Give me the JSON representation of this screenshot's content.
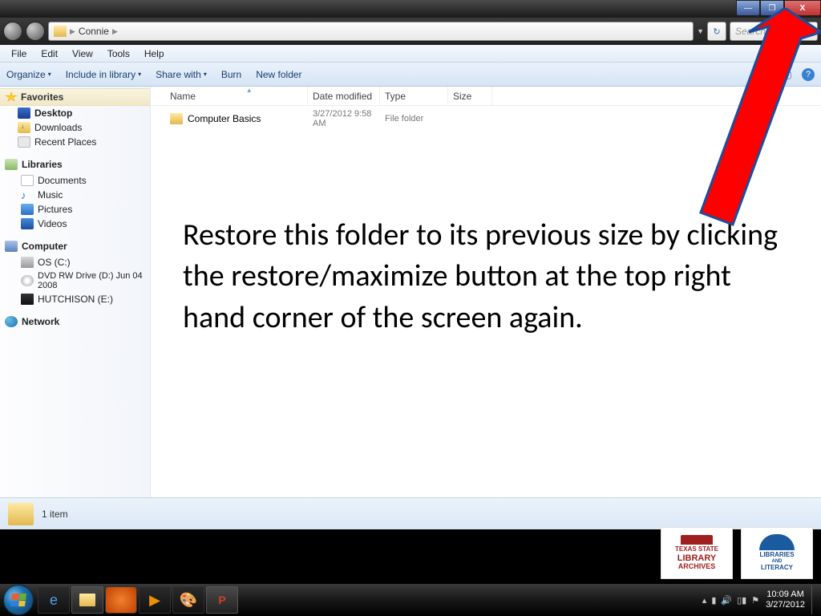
{
  "titlebar": {
    "min": "—",
    "max": "❐",
    "close": "X"
  },
  "address": {
    "folder": "Connie",
    "search_placeholder": "Search"
  },
  "menu": {
    "file": "File",
    "edit": "Edit",
    "view": "View",
    "tools": "Tools",
    "help": "Help"
  },
  "toolbar": {
    "organize": "Organize",
    "include": "Include in library",
    "share": "Share with",
    "burn": "Burn",
    "newfolder": "New folder"
  },
  "sidebar": {
    "favorites": "Favorites",
    "desktop": "Desktop",
    "downloads": "Downloads",
    "recent": "Recent Places",
    "libraries": "Libraries",
    "documents": "Documents",
    "music": "Music",
    "pictures": "Pictures",
    "videos": "Videos",
    "computer": "Computer",
    "osc": "OS (C:)",
    "dvd": "DVD RW Drive (D:) Jun 04 2008",
    "hutch": "HUTCHISON (E:)",
    "network": "Network"
  },
  "columns": {
    "name": "Name",
    "date": "Date modified",
    "type": "Type",
    "size": "Size"
  },
  "files": [
    {
      "name": "Computer Basics",
      "date": "3/27/2012 9:58 AM",
      "type": "File folder"
    }
  ],
  "instruction": "Restore this folder to its previous size by clicking the restore/maximize button at the top right hand corner of the screen again.",
  "status": "1 item",
  "logos": {
    "tslac1": "TEXAS STATE",
    "tslac2": "LIBRARY",
    "tslac3": "ARCHIVES",
    "lal1": "LIBRARIES",
    "lal2": "AND",
    "lal3": "LITERACY"
  },
  "tray": {
    "time": "10:09 AM",
    "date": "3/27/2012"
  }
}
